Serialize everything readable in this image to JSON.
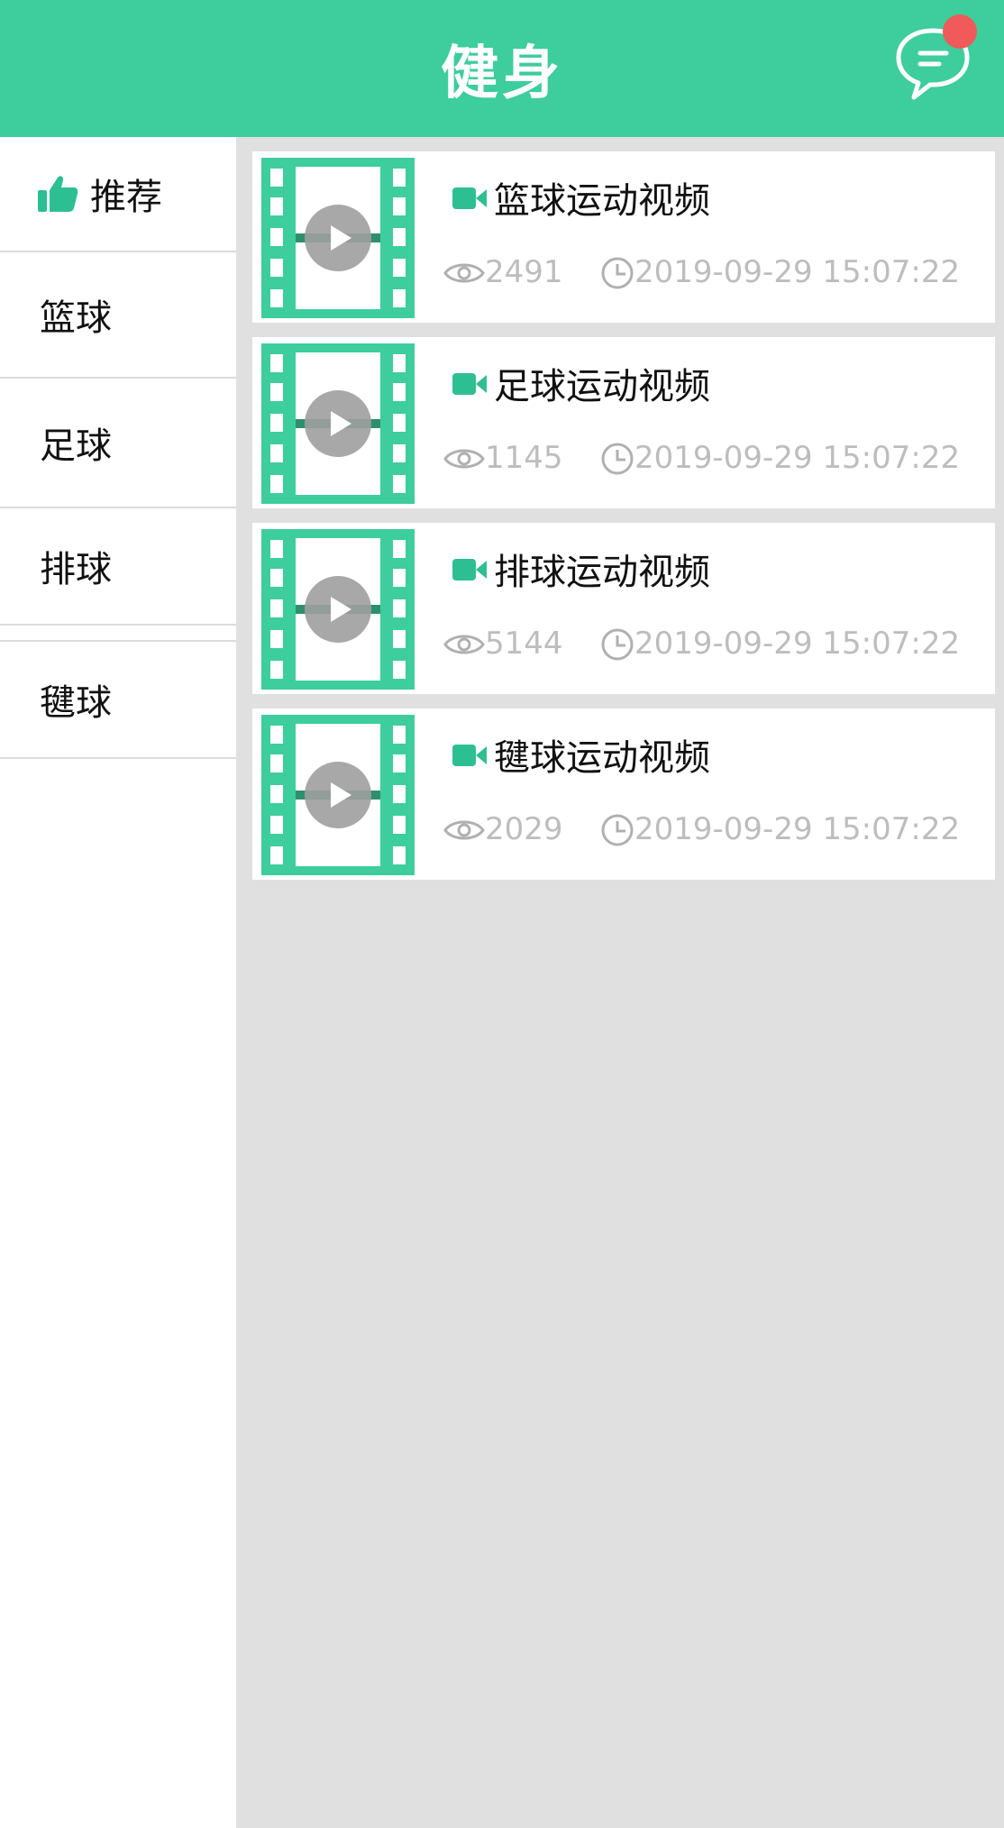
{
  "header": {
    "title": "健身",
    "message_icon": "chat-bubble-icon",
    "badge_color": "#f05a5a"
  },
  "colors": {
    "accent": "#3ecd9d",
    "icon_green": "#2dbf91",
    "content_bg": "#e0e0e0",
    "meta_text": "#bdbdbd"
  },
  "sidebar": {
    "items": [
      {
        "label": "推荐",
        "icon": "thumbs-up-icon",
        "active": true
      },
      {
        "label": "篮球"
      },
      {
        "label": "足球"
      },
      {
        "label": "排球"
      },
      {
        "label": "毽球"
      }
    ]
  },
  "videos": [
    {
      "title": "篮球运动视频",
      "views": "2491",
      "time": "2019-09-29 15:07:22"
    },
    {
      "title": "足球运动视频",
      "views": "1145",
      "time": "2019-09-29 15:07:22"
    },
    {
      "title": "排球运动视频",
      "views": "5144",
      "time": "2019-09-29 15:07:22"
    },
    {
      "title": "毽球运动视频",
      "views": "2029",
      "time": "2019-09-29 15:07:22"
    }
  ]
}
